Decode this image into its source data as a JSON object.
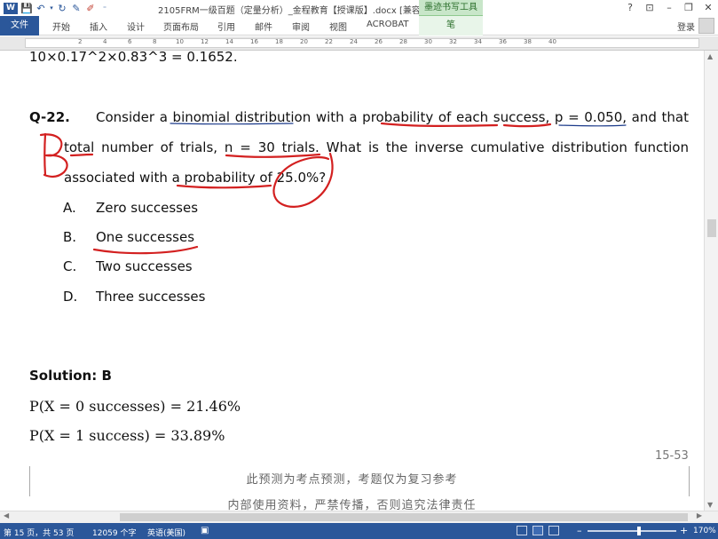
{
  "titlebar": {
    "doc_title": "2105FRM一级百题（定量分析）_金程教育【授课版】.docx [兼容模...",
    "context_tab_title": "墨迹书写工具",
    "help": "?",
    "restore_ribbon": "⊡",
    "minimize": "–",
    "maximize": "❐",
    "close": "✕"
  },
  "ribbon": {
    "file_tab": "文件",
    "tabs": [
      "开始",
      "插入",
      "设计",
      "页面布局",
      "引用",
      "邮件",
      "审阅",
      "视图",
      "ACROBAT"
    ],
    "context_tab": "笔",
    "login": "登录"
  },
  "ruler": {
    "numbers": [
      "2",
      "4",
      "6",
      "8",
      "10",
      "12",
      "14",
      "16",
      "18",
      "20",
      "22",
      "24",
      "26",
      "28",
      "30",
      "32",
      "34",
      "36",
      "38",
      "40"
    ]
  },
  "document": {
    "prev_line": "10×0.17^2×0.83^3 = 0.1652.",
    "question_number": "Q-22.",
    "question_line1": "Consider a binomial distribution with a probability of each success, p = 0.050, and that",
    "question_line2": "total number of trials, n = 30 trials. What is the inverse cumulative distribution function",
    "question_line3": "associated with a probability of 25.0%?",
    "options": [
      {
        "letter": "A.",
        "text": "Zero successes"
      },
      {
        "letter": "B.",
        "text": "One successes"
      },
      {
        "letter": "C.",
        "text": "Two successes"
      },
      {
        "letter": "D.",
        "text": "Three successes"
      }
    ],
    "solution_label": "Solution: B",
    "equation1": "P(X = 0 successes) = 21.46%",
    "equation2": "P(X = 1 success) = 33.89%",
    "page_number": "15-53",
    "footer_line1": "此预测为考点预测，考题仅为复习参考",
    "footer_line2": "内部使用资料，严禁传播，否则追究法律责任"
  },
  "annotations": {
    "ink_color": "#d32020",
    "handwritten_letter": "B"
  },
  "statusbar": {
    "page_info": "第 15 页，共 53 页",
    "word_count": "12059 个字",
    "language": "英语(美国)",
    "zoom_minus": "–",
    "zoom_plus": "+",
    "zoom": "170%"
  },
  "colors": {
    "accent": "#2b579a",
    "context_tab": "#c8e6c9"
  }
}
